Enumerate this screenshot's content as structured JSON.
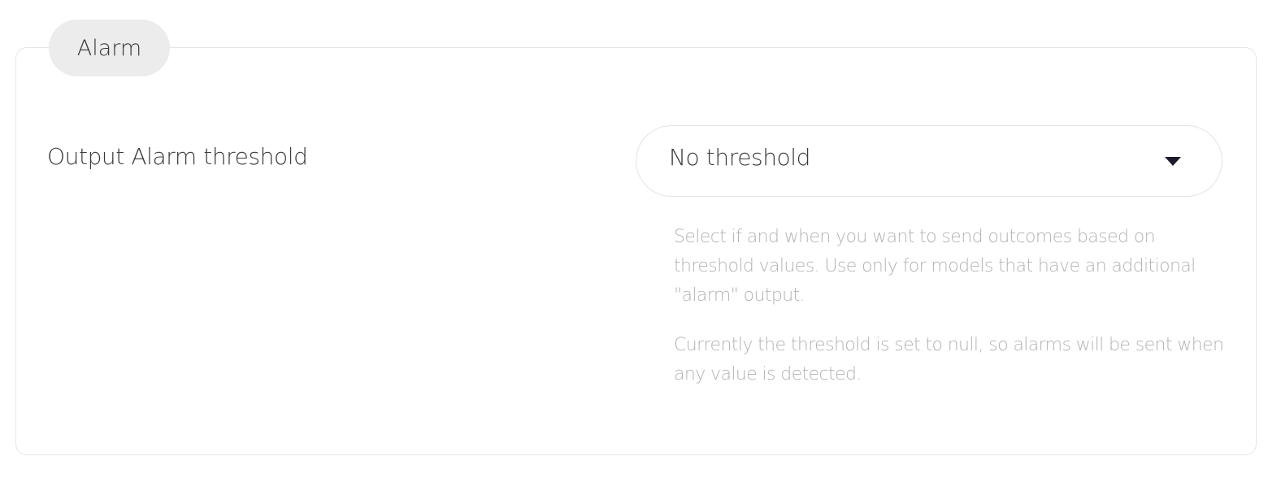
{
  "section": {
    "legend": "Alarm"
  },
  "field": {
    "label": "Output Alarm threshold",
    "select": {
      "selected": "No threshold",
      "caret_icon": "caret-down-icon"
    },
    "help": [
      "Select if and when you want to send outcomes based on threshold values. Use only for models that have an additional \"alarm\" output.",
      "Currently the threshold is set to null, so alarms will be sent when any value is detected."
    ]
  },
  "colors": {
    "text": "#3a3a3a",
    "help_text": "#b3b3b3",
    "legend_bg": "#ececec",
    "border": "#e6e6e6",
    "caret": "#1b1b2b"
  }
}
